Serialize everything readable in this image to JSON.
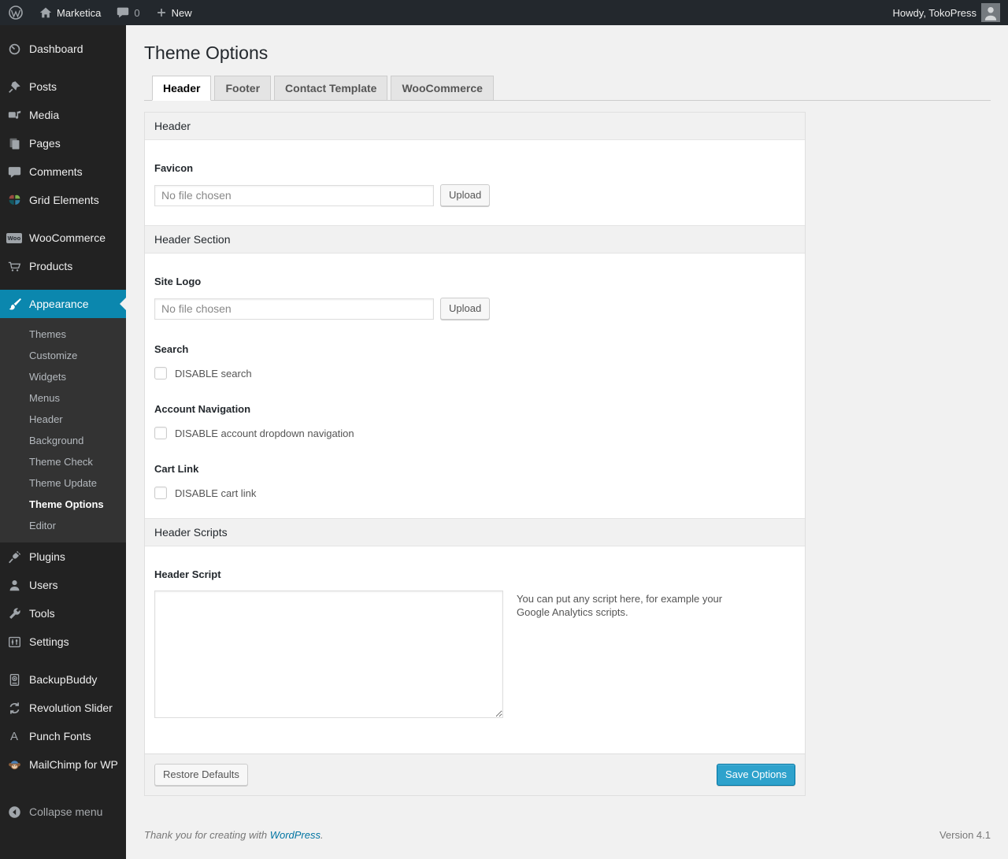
{
  "colors": {
    "menu_highlight": "#0b87ae",
    "primary_button": "#2ea2cc",
    "primary_button_border": "#0074a2",
    "link_blue": "#0074a2"
  },
  "admin_bar": {
    "site_name": "Marketica",
    "comments_count": "0",
    "new_label": "New",
    "howdy": "Howdy, TokoPress"
  },
  "sidebar": {
    "menu": [
      {
        "label": "Dashboard",
        "icon": "dashboard-icon"
      },
      {
        "label": "Posts",
        "icon": "pin-icon"
      },
      {
        "label": "Media",
        "icon": "media-icon"
      },
      {
        "label": "Pages",
        "icon": "pages-icon"
      },
      {
        "label": "Comments",
        "icon": "comment-bubble-icon"
      },
      {
        "label": "Grid Elements",
        "icon": "grid-elements-icon"
      },
      {
        "label": "WooCommerce",
        "icon": "woo-badge-icon"
      },
      {
        "label": "Products",
        "icon": "cart-icon"
      },
      {
        "label": "Appearance",
        "icon": "brush-icon",
        "selected": true
      },
      {
        "label": "Plugins",
        "icon": "plug-icon"
      },
      {
        "label": "Users",
        "icon": "user-icon"
      },
      {
        "label": "Tools",
        "icon": "wrench-icon"
      },
      {
        "label": "Settings",
        "icon": "sliders-icon"
      },
      {
        "label": "BackupBuddy",
        "icon": "backup-drive-icon"
      },
      {
        "label": "Revolution Slider",
        "icon": "refresh-arrows-icon"
      },
      {
        "label": "Punch Fonts",
        "icon": "letter-a-icon"
      },
      {
        "label": "MailChimp for WP",
        "icon": "monkey-icon"
      },
      {
        "label": "Collapse menu",
        "icon": "collapse-circle-icon"
      }
    ],
    "submenu": [
      {
        "label": "Themes"
      },
      {
        "label": "Customize"
      },
      {
        "label": "Widgets"
      },
      {
        "label": "Menus"
      },
      {
        "label": "Header"
      },
      {
        "label": "Background"
      },
      {
        "label": "Theme Check"
      },
      {
        "label": "Theme Update"
      },
      {
        "label": "Theme Options",
        "current": true
      },
      {
        "label": "Editor"
      }
    ],
    "woo_badge": "Woo",
    "punch_fonts_letter": "A"
  },
  "page": {
    "title": "Theme Options",
    "tabs": [
      {
        "label": "Header",
        "active": true
      },
      {
        "label": "Footer",
        "active": false
      },
      {
        "label": "Contact Template",
        "active": false
      },
      {
        "label": "WooCommerce",
        "active": false
      }
    ]
  },
  "panel": {
    "section_headers": {
      "header": "Header",
      "header_section": "Header Section",
      "header_scripts": "Header Scripts"
    },
    "favicon": {
      "label": "Favicon",
      "file_text": "No file chosen",
      "button": "Upload"
    },
    "site_logo": {
      "label": "Site Logo",
      "file_text": "No file chosen",
      "button": "Upload"
    },
    "search": {
      "label": "Search",
      "checkbox": "DISABLE search",
      "checked": false
    },
    "account_nav": {
      "label": "Account Navigation",
      "checkbox": "DISABLE account dropdown navigation",
      "checked": false
    },
    "cart_link": {
      "label": "Cart Link",
      "checkbox": "DISABLE cart link",
      "checked": false
    },
    "header_script": {
      "label": "Header Script",
      "value": "",
      "help": "You can put any script here, for example your Google Analytics scripts."
    },
    "buttons": {
      "restore": "Restore Defaults",
      "save": "Save Options"
    }
  },
  "footer": {
    "thanks_prefix": "Thank you for creating with ",
    "link": "WordPress",
    "suffix": ".",
    "version": "Version 4.1"
  }
}
